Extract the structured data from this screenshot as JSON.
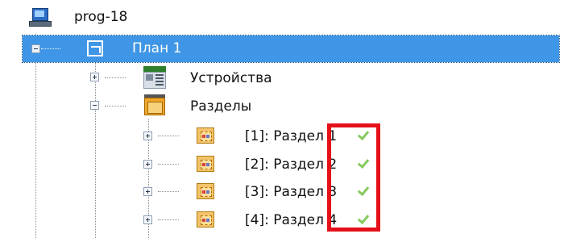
{
  "tree": {
    "root": {
      "label": "prog-18",
      "icon": "computer-icon"
    },
    "plan": {
      "label": "План 1",
      "icon": "plan-icon",
      "selected": true,
      "expanded": true
    },
    "devices": {
      "label": "Устройства",
      "icon": "devices-icon",
      "expanded": false
    },
    "sections": {
      "label": "Разделы",
      "icon": "sections-icon",
      "expanded": true,
      "items": [
        {
          "label": "[1]: Раздел 1",
          "status_icon": "check-icon"
        },
        {
          "label": "[2]: Раздел 2",
          "status_icon": "check-icon"
        },
        {
          "label": "[3]: Раздел 3",
          "status_icon": "check-icon"
        },
        {
          "label": "[4]: Раздел 4",
          "status_icon": "check-icon"
        }
      ]
    }
  },
  "colors": {
    "selection": "#3f96e6",
    "highlight_box": "#e5101a",
    "status_ok": "#86c95e"
  }
}
